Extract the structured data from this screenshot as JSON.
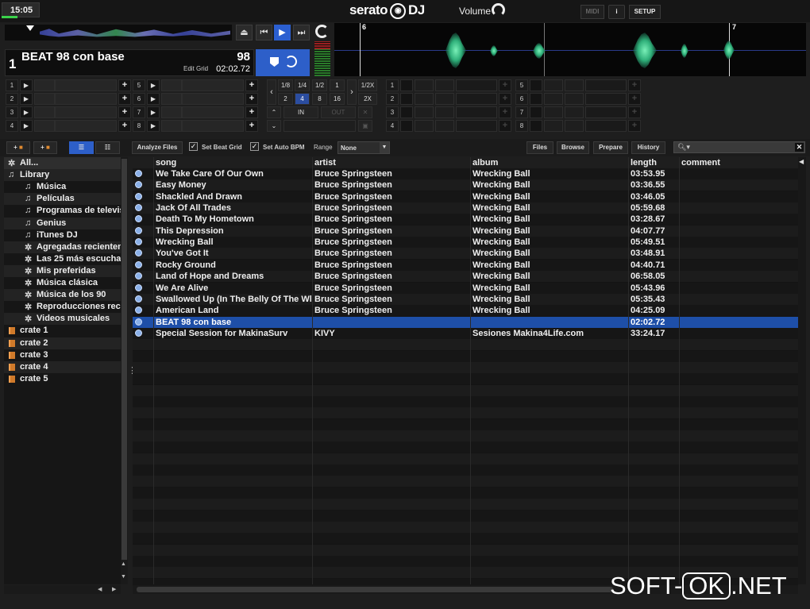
{
  "topbar": {
    "clock": "15:05",
    "logo": "serato",
    "logo_badge": "DJ",
    "volume_label": "Volume",
    "midi_label": "MIDI",
    "info_label": "i",
    "setup_label": "SETUP"
  },
  "deck": {
    "number": "1",
    "title": "BEAT 98 con base",
    "bpm": "98",
    "edit_grid": "Edit Grid",
    "time": "02:02.72",
    "beat_markers": [
      "6",
      "7"
    ]
  },
  "cue_slots_left": [
    "1",
    "2",
    "3",
    "4"
  ],
  "cue_slots_left2": [
    "5",
    "6",
    "7",
    "8"
  ],
  "cue_slots_right": [
    "1",
    "2",
    "3",
    "4"
  ],
  "cue_slots_right2": [
    "5",
    "6",
    "7",
    "8"
  ],
  "loop": {
    "row1": [
      "1/8",
      "1/4",
      "1/2",
      "1",
      "1/2X"
    ],
    "row2": [
      "2",
      "4",
      "8",
      "16",
      "2X"
    ],
    "in": "IN",
    "out": "OUT",
    "active": "4"
  },
  "toolbar": {
    "analyze": "Analyze Files",
    "set_beat_grid": "Set Beat Grid",
    "set_auto_bpm": "Set Auto BPM",
    "range_label": "Range",
    "range_value": "None",
    "files": "Files",
    "browse": "Browse",
    "prepare": "Prepare",
    "history": "History"
  },
  "sidebar": [
    {
      "icon": "✲",
      "label": "All...",
      "indent": 0
    },
    {
      "icon": "♫",
      "label": "Library",
      "indent": 0
    },
    {
      "icon": "♫",
      "label": "Música",
      "indent": 1
    },
    {
      "icon": "♫",
      "label": "Películas",
      "indent": 1
    },
    {
      "icon": "♫",
      "label": "Programas de televisi",
      "indent": 1
    },
    {
      "icon": "♫",
      "label": "Genius",
      "indent": 1
    },
    {
      "icon": "♫",
      "label": "iTunes DJ",
      "indent": 1
    },
    {
      "icon": "✲",
      "label": "Agregadas recientem",
      "indent": 1
    },
    {
      "icon": "✲",
      "label": "Las 25 más escuchad",
      "indent": 1
    },
    {
      "icon": "✲",
      "label": "Mis preferidas",
      "indent": 1
    },
    {
      "icon": "✲",
      "label": "Música clásica",
      "indent": 1
    },
    {
      "icon": "✲",
      "label": "Música de los 90",
      "indent": 1
    },
    {
      "icon": "✲",
      "label": "Reproducciones recie",
      "indent": 1
    },
    {
      "icon": "✲",
      "label": "Videos musicales",
      "indent": 1
    },
    {
      "icon": "crate",
      "label": "crate 1",
      "indent": 0
    },
    {
      "icon": "crate",
      "label": "crate 2",
      "indent": 0
    },
    {
      "icon": "crate",
      "label": "crate 3",
      "indent": 0
    },
    {
      "icon": "crate",
      "label": "crate 4",
      "indent": 0
    },
    {
      "icon": "crate",
      "label": "crate 5",
      "indent": 0
    }
  ],
  "table": {
    "headers": {
      "song": "song",
      "artist": "artist",
      "album": "album",
      "length": "length",
      "comment": "comment"
    },
    "rows": [
      {
        "song": "We Take Care Of Our Own",
        "artist": "Bruce Springsteen",
        "album": "Wrecking Ball",
        "length": "03:53.95"
      },
      {
        "song": "Easy Money",
        "artist": "Bruce Springsteen",
        "album": "Wrecking Ball",
        "length": "03:36.55"
      },
      {
        "song": "Shackled And Drawn",
        "artist": "Bruce Springsteen",
        "album": "Wrecking Ball",
        "length": "03:46.05"
      },
      {
        "song": "Jack Of All Trades",
        "artist": "Bruce Springsteen",
        "album": "Wrecking Ball",
        "length": "05:59.68"
      },
      {
        "song": "Death To My Hometown",
        "artist": "Bruce Springsteen",
        "album": "Wrecking Ball",
        "length": "03:28.67"
      },
      {
        "song": "This Depression",
        "artist": "Bruce Springsteen",
        "album": "Wrecking Ball",
        "length": "04:07.77"
      },
      {
        "song": "Wrecking Ball",
        "artist": "Bruce Springsteen",
        "album": "Wrecking Ball",
        "length": "05:49.51"
      },
      {
        "song": "You've Got It",
        "artist": "Bruce Springsteen",
        "album": "Wrecking Ball",
        "length": "03:48.91"
      },
      {
        "song": "Rocky Ground",
        "artist": "Bruce Springsteen",
        "album": "Wrecking Ball",
        "length": "04:40.71"
      },
      {
        "song": "Land of Hope and Dreams",
        "artist": "Bruce Springsteen",
        "album": "Wrecking Ball",
        "length": "06:58.05"
      },
      {
        "song": "We Are Alive",
        "artist": "Bruce Springsteen",
        "album": "Wrecking Ball",
        "length": "05:43.96"
      },
      {
        "song": "Swallowed Up (In The Belly Of The Wh",
        "artist": "Bruce Springsteen",
        "album": "Wrecking Ball",
        "length": "05:35.43"
      },
      {
        "song": "American Land",
        "artist": "Bruce Springsteen",
        "album": "Wrecking Ball",
        "length": "04:25.09"
      },
      {
        "song": "BEAT 98 con base",
        "artist": "",
        "album": "",
        "length": "02:02.72"
      },
      {
        "song": "Special Session for MakinaSurv",
        "artist": "KIVY",
        "album": "Sesiones Makina4Life.com",
        "length": "33:24.17"
      }
    ],
    "selected_index": 13
  },
  "watermark": {
    "pre": "SOFT-",
    "ok": "OK",
    "post": ".NET"
  }
}
